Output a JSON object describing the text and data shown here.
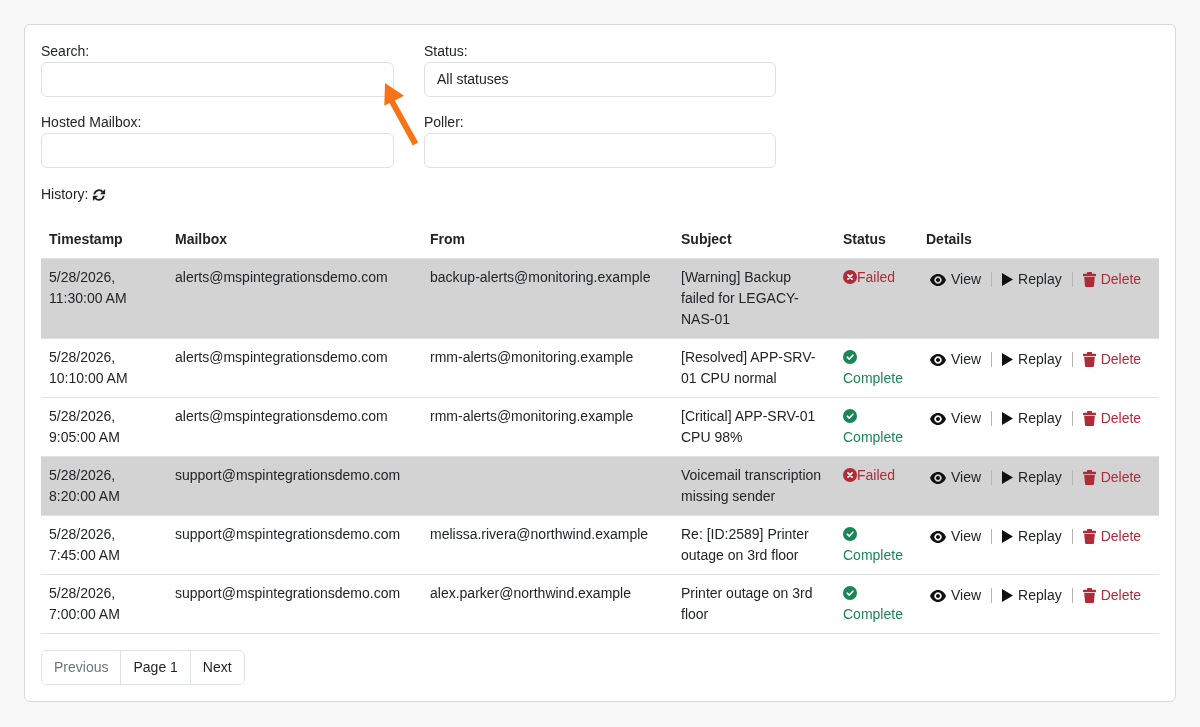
{
  "filters": [
    {
      "label": "Search:"
    },
    {
      "label": "Status:",
      "value": "All statuses"
    },
    {
      "label": "Hosted Mailbox:"
    },
    {
      "label": "Poller:"
    }
  ],
  "history": {
    "label": "History:"
  },
  "table": {
    "columns": [
      "Timestamp",
      "Mailbox",
      "From",
      "Subject",
      "Status",
      "Details"
    ],
    "rows": [
      {
        "kind": "failed",
        "timestamp": "5/28/2026, 11:30:00 AM",
        "mailbox": "alerts@mspintegrationsdemo.com",
        "from": "backup-alerts@monitoring.example",
        "subject": "[Warning] Backup failed for LEGACY-NAS-01",
        "status": "Failed",
        "actions": [
          {
            "kind": "view",
            "label": "View"
          },
          {
            "kind": "replay",
            "label": "Replay"
          },
          {
            "kind": "delete",
            "label": "Delete"
          }
        ]
      },
      {
        "kind": "complete",
        "timestamp": "5/28/2026, 10:10:00 AM",
        "mailbox": "alerts@mspintegrationsdemo.com",
        "from": "rmm-alerts@monitoring.example",
        "subject": "[Resolved] APP-SRV-01 CPU normal",
        "status": "Complete",
        "actions": [
          {
            "kind": "view",
            "label": "View"
          },
          {
            "kind": "replay",
            "label": "Replay"
          },
          {
            "kind": "delete",
            "label": "Delete"
          }
        ]
      },
      {
        "kind": "complete",
        "timestamp": "5/28/2026, 9:05:00 AM",
        "mailbox": "alerts@mspintegrationsdemo.com",
        "from": "rmm-alerts@monitoring.example",
        "subject": "[Critical] APP-SRV-01 CPU 98%",
        "status": "Complete",
        "actions": [
          {
            "kind": "view",
            "label": "View"
          },
          {
            "kind": "replay",
            "label": "Replay"
          },
          {
            "kind": "delete",
            "label": "Delete"
          }
        ]
      },
      {
        "kind": "failed",
        "timestamp": "5/28/2026, 8:20:00 AM",
        "mailbox": "support@mspintegrationsdemo.com",
        "subject": "Voicemail transcription missing sender",
        "status": "Failed",
        "actions": [
          {
            "kind": "view",
            "label": "View"
          },
          {
            "kind": "replay",
            "label": "Replay"
          },
          {
            "kind": "delete",
            "label": "Delete"
          }
        ]
      },
      {
        "kind": "complete",
        "timestamp": "5/28/2026, 7:45:00 AM",
        "mailbox": "support@mspintegrationsdemo.com",
        "from": "melissa.rivera@northwind.example",
        "subject": "Re: [ID:2589] Printer outage on 3rd floor",
        "status": "Complete",
        "actions": [
          {
            "kind": "view",
            "label": "View"
          },
          {
            "kind": "replay",
            "label": "Replay"
          },
          {
            "kind": "delete",
            "label": "Delete"
          }
        ]
      },
      {
        "kind": "complete",
        "timestamp": "5/28/2026, 7:00:00 AM",
        "mailbox": "support@mspintegrationsdemo.com",
        "from": "alex.parker@northwind.example",
        "subject": "Printer outage on 3rd floor",
        "status": "Complete",
        "actions": [
          {
            "kind": "view",
            "label": "View"
          },
          {
            "kind": "replay",
            "label": "Replay"
          },
          {
            "kind": "delete",
            "label": "Delete"
          }
        ]
      }
    ]
  },
  "pagination": [
    {
      "label": "Previous",
      "disabled": true
    },
    {
      "label": "Page 1",
      "disabled": false
    },
    {
      "label": "Next",
      "disabled": false
    }
  ]
}
